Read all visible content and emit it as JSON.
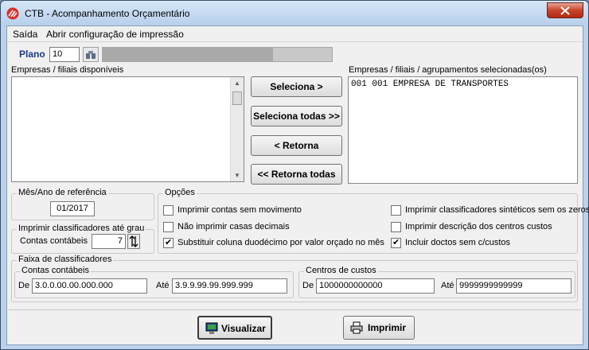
{
  "window": {
    "title": "CTB - Acompanhamento Orçamentário"
  },
  "menu": {
    "items": [
      "Saída",
      "Abrir configuração de impressão"
    ]
  },
  "plano": {
    "label": "Plano",
    "value": "10"
  },
  "available": {
    "label": "Empresas / filiais disponíveis"
  },
  "selected": {
    "label": "Empresas / filiais / agrupamentos selecionadas(os)",
    "items": [
      "001 001 EMPRESA DE TRANSPORTES"
    ]
  },
  "buttons": {
    "seleciona": "Seleciona >",
    "seleciona_todas": "Seleciona todas >>",
    "retorna": "< Retorna",
    "retorna_todas": "<< Retorna todas",
    "visualizar": "Visualizar",
    "imprimir": "Imprimir"
  },
  "referencia": {
    "label": "Mês/Ano de referência",
    "value": "01/2017"
  },
  "classificadores": {
    "label": "Imprimir classificadores até grau",
    "contas_label": "Contas contábeis",
    "value": "7"
  },
  "opcoes": {
    "label": "Opções",
    "items": [
      {
        "label": "Imprimir contas sem movimento",
        "checked": false
      },
      {
        "label": "Não imprimir casas decimais",
        "checked": false
      },
      {
        "label": "Substituir coluna duodécimo por valor orçado no mês",
        "checked": true
      },
      {
        "label": "Imprimir classificadores sintéticos sem os zeros",
        "checked": false
      },
      {
        "label": "Imprimir descrição dos centros custos",
        "checked": false
      },
      {
        "label": "Incluir doctos sem c/custos",
        "checked": true
      }
    ]
  },
  "faixa": {
    "label": "Faixa de classificadores",
    "contas": {
      "label": "Contas contábeis",
      "de_label": "De",
      "de": "3.0.0.00.00.000.000",
      "ate_label": "Até",
      "ate": "3.9.9.99.99.999.999"
    },
    "centros": {
      "label": "Centros de custos",
      "de_label": "De",
      "de": "1000000000000",
      "ate_label": "Até",
      "ate": "9999999999999"
    }
  },
  "colors": {
    "title_bg": "#bcd2ec",
    "close": "#c7432a",
    "plano_label": "#1a3a8a"
  }
}
